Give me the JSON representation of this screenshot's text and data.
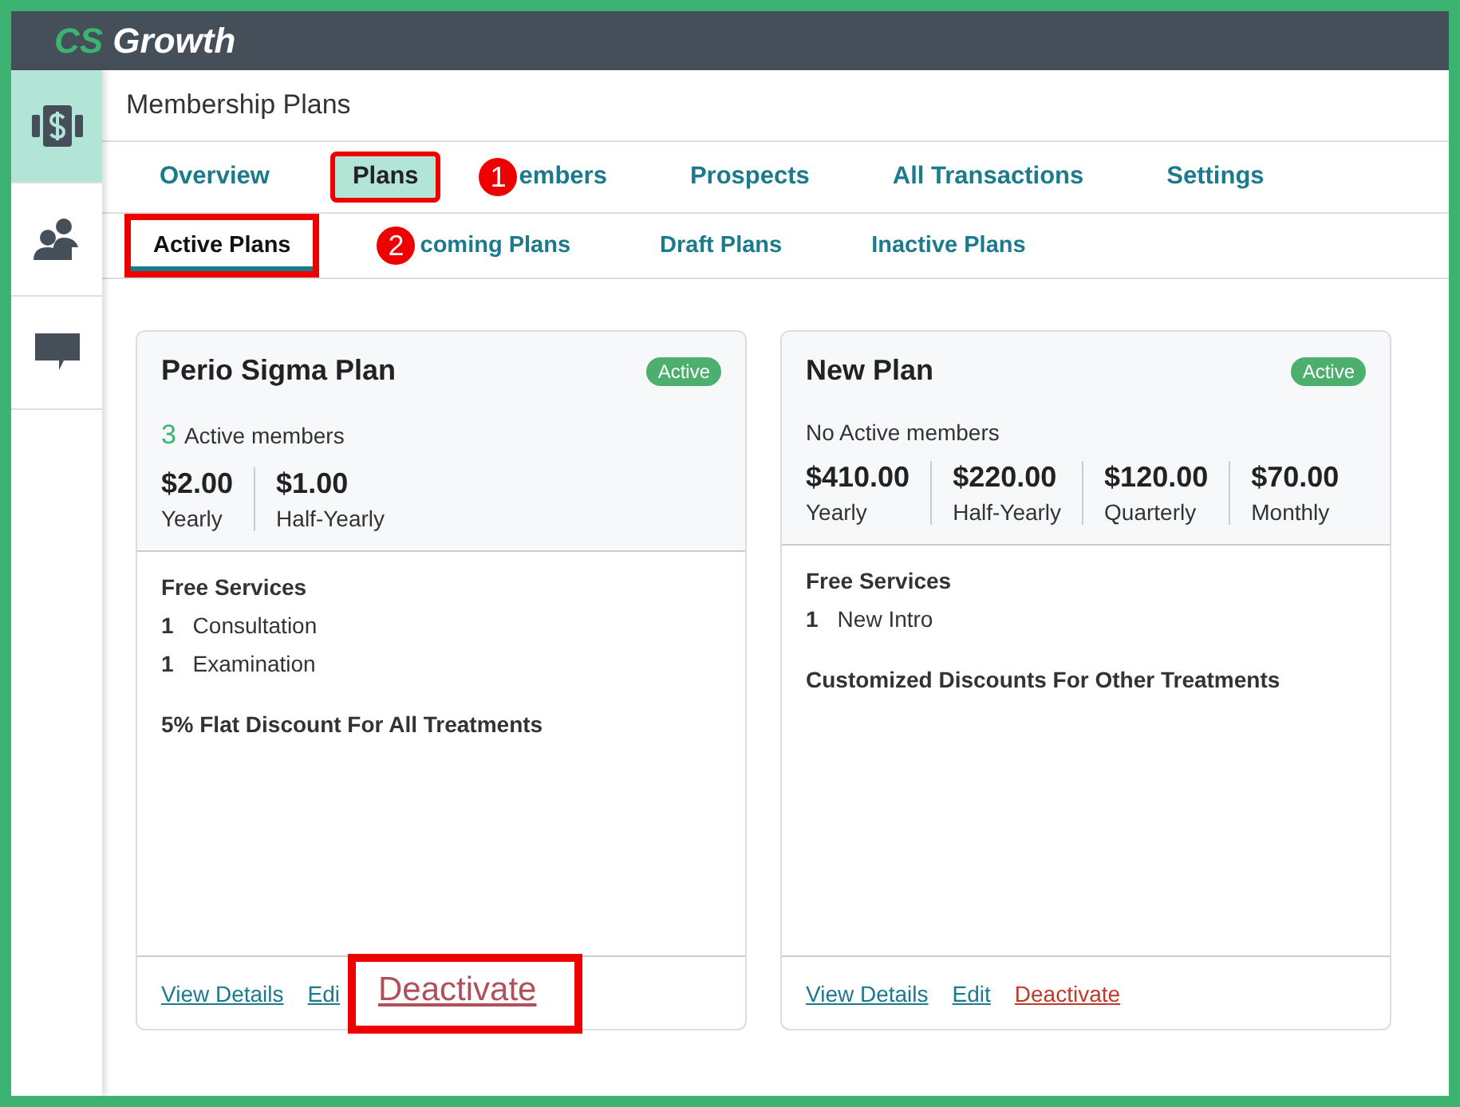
{
  "brand": {
    "accent": "CS",
    "name": "Growth"
  },
  "sidebar": {
    "items": [
      {
        "kind": "money",
        "selected": true
      },
      {
        "kind": "people",
        "selected": false
      },
      {
        "kind": "chat",
        "selected": false
      }
    ]
  },
  "page_title": "Membership Plans",
  "tabs": [
    {
      "label": "Overview",
      "selected": false,
      "highlighted": false
    },
    {
      "label": "Plans",
      "selected": true,
      "highlighted": true
    },
    {
      "label": "embers",
      "selected": false,
      "highlighted": false,
      "marker": "1"
    },
    {
      "label": "Prospects",
      "selected": false,
      "highlighted": false
    },
    {
      "label": "All Transactions",
      "selected": false,
      "highlighted": false
    },
    {
      "label": "Settings",
      "selected": false,
      "highlighted": false
    }
  ],
  "subtabs": [
    {
      "label": "Active Plans",
      "selected": true,
      "highlighted": true
    },
    {
      "label": "coming Plans",
      "selected": false,
      "highlighted": false,
      "marker": "2"
    },
    {
      "label": "Draft Plans",
      "selected": false,
      "highlighted": false
    },
    {
      "label": "Inactive Plans",
      "selected": false,
      "highlighted": false
    }
  ],
  "cards": [
    {
      "name": "Perio Sigma Plan",
      "status": "Active",
      "members_count": "3",
      "members_label": "Active members",
      "prices": [
        {
          "amount": "$2.00",
          "period": "Yearly"
        },
        {
          "amount": "$1.00",
          "period": "Half-Yearly"
        }
      ],
      "services_title": "Free Services",
      "services": [
        {
          "qty": "1",
          "name": "Consultation"
        },
        {
          "qty": "1",
          "name": "Examination"
        }
      ],
      "discount": "5% Flat Discount For All Treatments",
      "actions": [
        {
          "label": "View Details",
          "kind": "link",
          "highlighted": false
        },
        {
          "label": "Edi",
          "kind": "link",
          "highlighted": false
        },
        {
          "label": "Deactivate",
          "kind": "danger",
          "highlighted": true
        }
      ]
    },
    {
      "name": "New Plan",
      "status": "Active",
      "members_label": "No Active members",
      "prices": [
        {
          "amount": "$410.00",
          "period": "Yearly"
        },
        {
          "amount": "$220.00",
          "period": "Half-Yearly"
        },
        {
          "amount": "$120.00",
          "period": "Quarterly"
        },
        {
          "amount": "$70.00",
          "period": "Monthly"
        }
      ],
      "services_title": "Free Services",
      "services": [
        {
          "qty": "1",
          "name": "New Intro"
        }
      ],
      "discount": "Customized Discounts For Other Treatments",
      "actions": [
        {
          "label": "View Details",
          "kind": "link",
          "highlighted": false
        },
        {
          "label": "Edit",
          "kind": "link",
          "highlighted": false
        },
        {
          "label": "Deactivate",
          "kind": "danger",
          "highlighted": false
        }
      ]
    }
  ]
}
